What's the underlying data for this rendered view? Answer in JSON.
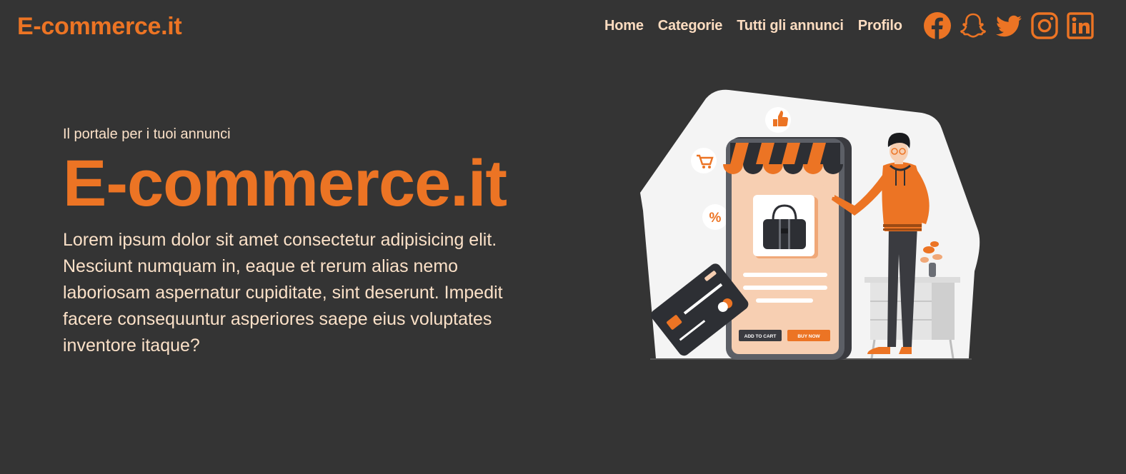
{
  "navbar": {
    "brand": "E-commerce.it",
    "links": [
      "Home",
      "Categorie",
      "Tutti gli annunci",
      "Profilo"
    ],
    "social_icons": [
      "facebook-icon",
      "snapchat-icon",
      "twitter-icon",
      "instagram-icon",
      "linkedin-icon"
    ]
  },
  "hero": {
    "tagline": "Il portale per i tuoi annunci",
    "title": "E-commerce.it",
    "description": "Lorem ipsum dolor sit amet consectetur adipisicing elit. Nesciunt numquam in, eaque et rerum alias nemo laboriosam aspernatur cupiditate, sint deserunt. Impedit facere consequuntur asperiores saepe eius voluptates inventore itaque?"
  },
  "illustration": {
    "add_to_cart_label": "ADD TO CART",
    "buy_now_label": "BUY NOW",
    "percent_symbol": "%"
  },
  "colors": {
    "background": "#343434",
    "accent": "#ec7424",
    "text_light": "#fbe1c8"
  }
}
